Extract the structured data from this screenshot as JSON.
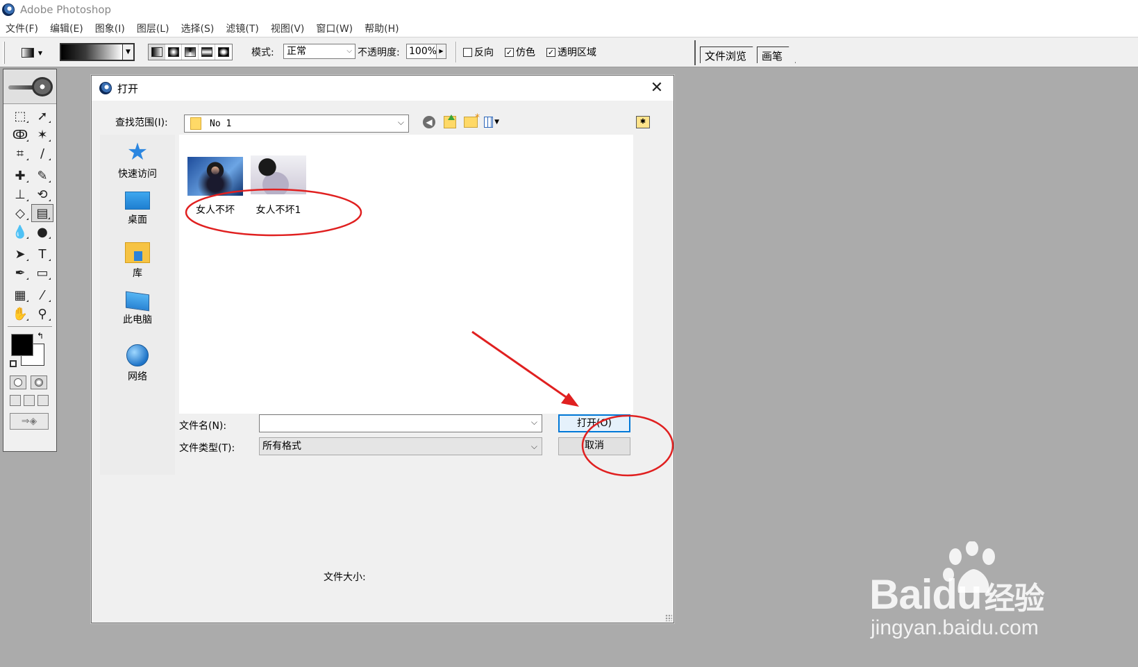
{
  "app": {
    "title": "Adobe Photoshop"
  },
  "menubar": {
    "items": [
      "文件(F)",
      "编辑(E)",
      "图象(I)",
      "图层(L)",
      "选择(S)",
      "滤镜(T)",
      "视图(V)",
      "窗口(W)",
      "帮助(H)"
    ]
  },
  "options": {
    "mode_label": "模式:",
    "mode_value": "正常",
    "opacity_label": "不透明度:",
    "opacity_value": "100%",
    "reverse_label": "反向",
    "reverse_checked": false,
    "dither_label": "仿色",
    "dither_checked": true,
    "transparency_label": "透明区域",
    "transparency_checked": true,
    "gradient_types": [
      "linear-gradient-icon",
      "radial-gradient-icon",
      "angle-gradient-icon",
      "reflected-gradient-icon",
      "diamond-gradient-icon"
    ]
  },
  "palette_well": {
    "tabs": [
      "文件浏览",
      "画笔"
    ]
  },
  "toolbox": {
    "active_tool": "gradient-tool",
    "foreground_color": "#000000",
    "background_color": "#ffffff"
  },
  "dialog": {
    "title": "打开",
    "look_in_label": "查找范围(I):",
    "look_in_value": "No 1",
    "places": [
      {
        "label": "快速访问",
        "icon": "quick-access-star-icon"
      },
      {
        "label": "桌面",
        "icon": "desktop-icon"
      },
      {
        "label": "库",
        "icon": "library-folder-icon"
      },
      {
        "label": "此电脑",
        "icon": "this-pc-icon"
      },
      {
        "label": "网络",
        "icon": "network-globe-icon"
      }
    ],
    "files": [
      {
        "name": "女人不坏"
      },
      {
        "name": "女人不坏1"
      }
    ],
    "file_name_label": "文件名(N):",
    "file_name_value": "",
    "file_type_label": "文件类型(T):",
    "file_type_value": "所有格式",
    "open_button": "打开(O)",
    "cancel_button": "取消",
    "file_size_label": "文件大小:"
  },
  "annotation_colors": {
    "circle": "#e02020",
    "arrow": "#e02020"
  },
  "watermark": {
    "brand": "Bai",
    "brand_suffix": "du",
    "brand_cn": "经验",
    "url": "jingyan.baidu.com"
  }
}
